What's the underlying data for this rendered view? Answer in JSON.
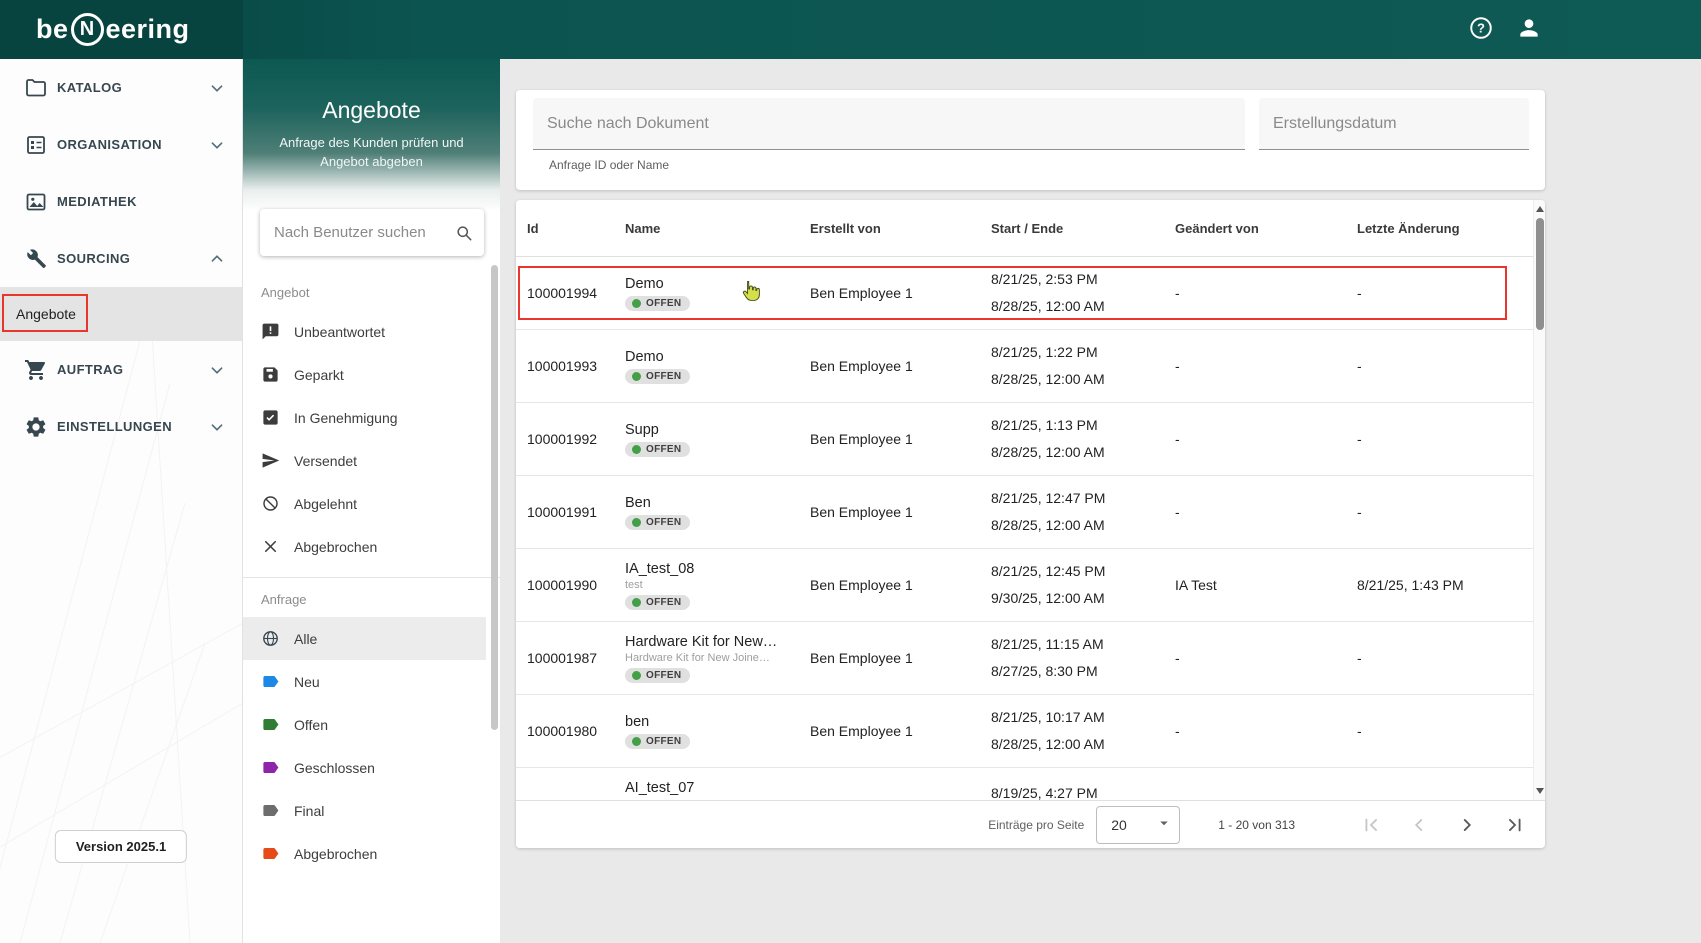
{
  "colors": {
    "topbar_teal": "#0c5450",
    "logo_block_teal": "#07443f",
    "status_open_green": "#43a047",
    "annotation_red": "#e8352e",
    "selected_gray": "#ececec"
  },
  "topbar": {
    "logo_prefix": "be",
    "logo_circled": "N",
    "logo_suffix": "eering"
  },
  "sidebar": {
    "items": {
      "katalog": "KATALOG",
      "organisation": "ORGANISATION",
      "mediathek": "MEDIATHEK",
      "sourcing": "SOURCING",
      "auftrag": "AUFTRAG",
      "einstellungen": "EINSTELLUNGEN"
    },
    "active_sub_item": "Angebote",
    "version_label": "Version 2025.1"
  },
  "panel": {
    "title": "Angebote",
    "subtitle": "Anfrage des Kunden prüfen und Angebot abgeben",
    "user_search_placeholder": "Nach Benutzer suchen",
    "angebot_heading": "Angebot",
    "angebot_items": [
      "Unbeantwortet",
      "Geparkt",
      "In Genehmigung",
      "Versendet",
      "Abgelehnt",
      "Abgebrochen"
    ],
    "anfrage_heading": "Anfrage",
    "anfrage_items": [
      {
        "label": "Alle",
        "color": "#37474f",
        "selected": true
      },
      {
        "label": "Neu",
        "color": "#1e88e5"
      },
      {
        "label": "Offen",
        "color": "#2e7d32"
      },
      {
        "label": "Geschlossen",
        "color": "#8e24aa"
      },
      {
        "label": "Final",
        "color": "#6d6d6d"
      },
      {
        "label": "Abgebrochen",
        "color": "#e64a19"
      }
    ]
  },
  "filters": {
    "document_search_placeholder": "Suche nach Dokument",
    "document_search_helper": "Anfrage ID oder Name",
    "date_placeholder": "Erstellungsdatum"
  },
  "table": {
    "columns": [
      "Id",
      "Name",
      "Erstellt von",
      "Start / Ende",
      "Geändert von",
      "Letzte Änderung"
    ],
    "status_open_color": "#43a047",
    "rows": [
      {
        "id": "100001994",
        "name": "Demo",
        "status": "OFFEN",
        "created_by": "Ben Employee 1",
        "start": "8/21/25, 2:53 PM",
        "end": "8/28/25, 12:00 AM",
        "changed_by": "-",
        "last_change": "-",
        "highlighted": true
      },
      {
        "id": "100001993",
        "name": "Demo",
        "status": "OFFEN",
        "created_by": "Ben Employee 1",
        "start": "8/21/25, 1:22 PM",
        "end": "8/28/25, 12:00 AM",
        "changed_by": "-",
        "last_change": "-"
      },
      {
        "id": "100001992",
        "name": "Supp",
        "status": "OFFEN",
        "created_by": "Ben Employee 1",
        "start": "8/21/25, 1:13 PM",
        "end": "8/28/25, 12:00 AM",
        "changed_by": "-",
        "last_change": "-"
      },
      {
        "id": "100001991",
        "name": "Ben",
        "status": "OFFEN",
        "created_by": "Ben Employee 1",
        "start": "8/21/25, 12:47 PM",
        "end": "8/28/25, 12:00 AM",
        "changed_by": "-",
        "last_change": "-"
      },
      {
        "id": "100001990",
        "name": "IA_test_08",
        "sub": "test",
        "status": "OFFEN",
        "created_by": "Ben Employee 1",
        "start": "8/21/25, 12:45 PM",
        "end": "9/30/25, 12:00 AM",
        "changed_by": "IA Test",
        "last_change": "8/21/25, 1:43 PM"
      },
      {
        "id": "100001987",
        "name": "Hardware Kit for New…",
        "sub": "Hardware Kit for New Joine…",
        "status": "OFFEN",
        "created_by": "Ben Employee 1",
        "start": "8/21/25, 11:15 AM",
        "end": "8/27/25, 8:30 PM",
        "changed_by": "-",
        "last_change": "-"
      },
      {
        "id": "100001980",
        "name": "ben",
        "status": "OFFEN",
        "created_by": "Ben Employee 1",
        "start": "8/21/25, 10:17 AM",
        "end": "8/28/25, 12:00 AM",
        "changed_by": "-",
        "last_change": "-"
      },
      {
        "id": "",
        "name": "AI_test_07",
        "start": "8/19/25, 4:27 PM",
        "partial": true
      }
    ]
  },
  "pagination": {
    "per_page_label": "Einträge pro Seite",
    "page_size": "20",
    "range_label": "1 - 20 von 313"
  }
}
